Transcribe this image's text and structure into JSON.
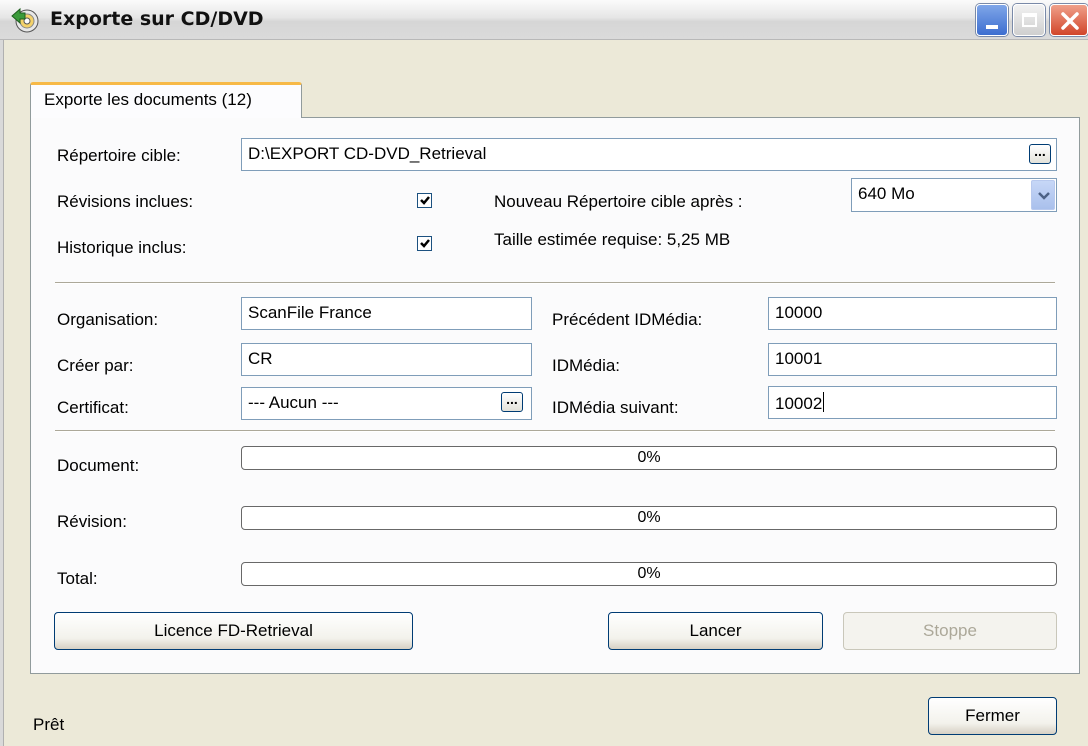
{
  "window": {
    "title": "Exporte sur CD/DVD"
  },
  "icons": {
    "app": "cd-export-icon",
    "minimize": "minimize-icon",
    "maximize": "maximize-icon",
    "close": "close-icon",
    "checkmark": "checkmark-icon",
    "dropdown": "chevron-down-icon"
  },
  "tab": {
    "label": "Exporte les documents  (12)"
  },
  "target": {
    "label": "Répertoire cible:",
    "value": "D:\\EXPORT CD-DVD_Retrieval",
    "browse_label": "..."
  },
  "revisions": {
    "label": "Révisions inclues:",
    "checked": true
  },
  "history": {
    "label": "Historique inclus:",
    "checked": true
  },
  "new_target": {
    "label": "Nouveau Répertoire cible après :",
    "selected": "640 Mo"
  },
  "estimate": {
    "text": "Taille estimée requise: 5,25 MB"
  },
  "organisation": {
    "label": "Organisation:",
    "value": "ScanFile France"
  },
  "created_by": {
    "label": "Créer par:",
    "value": "CR"
  },
  "certificate": {
    "label": "Certificat:",
    "value": "--- Aucun ---",
    "browse_label": "..."
  },
  "previous_media": {
    "label": "Précédent IDMédia:",
    "value": "10000"
  },
  "media_id": {
    "label": "IDMédia:",
    "value": "10001"
  },
  "next_media": {
    "label": "IDMédia suivant:",
    "value": "10002"
  },
  "progress": {
    "document": {
      "label": "Document:",
      "text": "0%",
      "value": 0
    },
    "revision": {
      "label": "Révision:",
      "text": "0%",
      "value": 0
    },
    "total": {
      "label": "Total:",
      "text": "0%",
      "value": 0
    }
  },
  "buttons": {
    "license": "Licence FD-Retrieval",
    "start": "Lancer",
    "stop": "Stoppe",
    "close": "Fermer"
  },
  "status": {
    "text": "Prêt"
  }
}
